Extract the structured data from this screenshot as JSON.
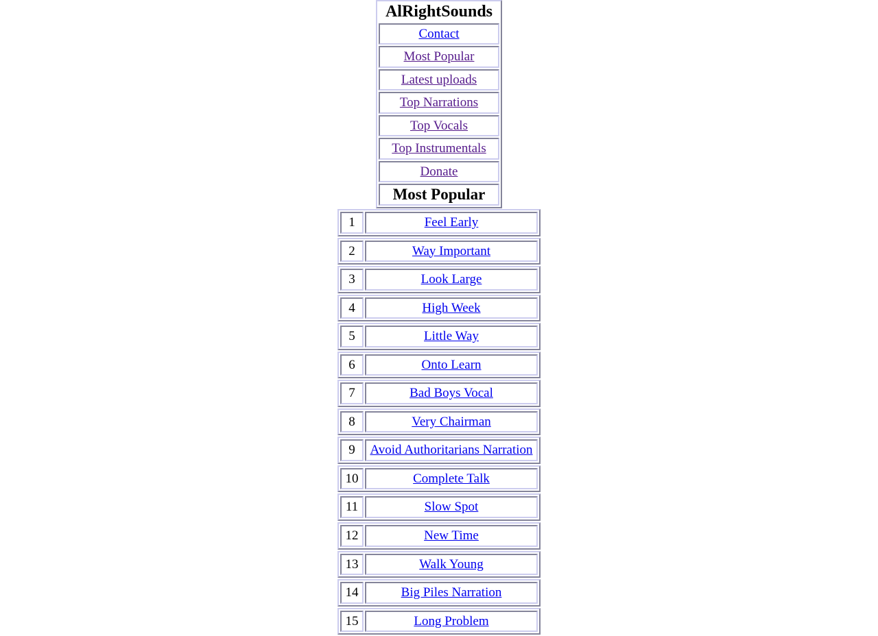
{
  "site": {
    "title": "AlRightSounds"
  },
  "nav": {
    "items": [
      {
        "label": "Contact",
        "state": "new"
      },
      {
        "label": "Most Popular",
        "state": "visited"
      },
      {
        "label": "Latest uploads",
        "state": "visited"
      },
      {
        "label": "Top Narrations",
        "state": "visited"
      },
      {
        "label": "Top Vocals",
        "state": "visited"
      },
      {
        "label": "Top Instrumentals",
        "state": "visited"
      },
      {
        "label": "Donate",
        "state": "visited"
      }
    ]
  },
  "section": {
    "heading": "Most Popular"
  },
  "list": {
    "rows": [
      {
        "rank": "1",
        "title": "Feel Early"
      },
      {
        "rank": "2",
        "title": "Way Important"
      },
      {
        "rank": "3",
        "title": "Look Large"
      },
      {
        "rank": "4",
        "title": "High Week"
      },
      {
        "rank": "5",
        "title": "Little Way"
      },
      {
        "rank": "6",
        "title": "Onto Learn"
      },
      {
        "rank": "7",
        "title": "Bad Boys Vocal"
      },
      {
        "rank": "8",
        "title": "Very Chairman"
      },
      {
        "rank": "9",
        "title": "Avoid Authoritarians Narration"
      },
      {
        "rank": "10",
        "title": "Complete Talk"
      },
      {
        "rank": "11",
        "title": "Slow Spot"
      },
      {
        "rank": "12",
        "title": "New Time"
      },
      {
        "rank": "13",
        "title": "Walk Young"
      },
      {
        "rank": "14",
        "title": "Big Piles Narration"
      },
      {
        "rank": "15",
        "title": "Long Problem"
      }
    ]
  },
  "colors": {
    "border": "#ccccee",
    "link_new": "#0000ee",
    "link_visited": "#551a8b",
    "text": "#000000",
    "background": "#ffffff"
  }
}
